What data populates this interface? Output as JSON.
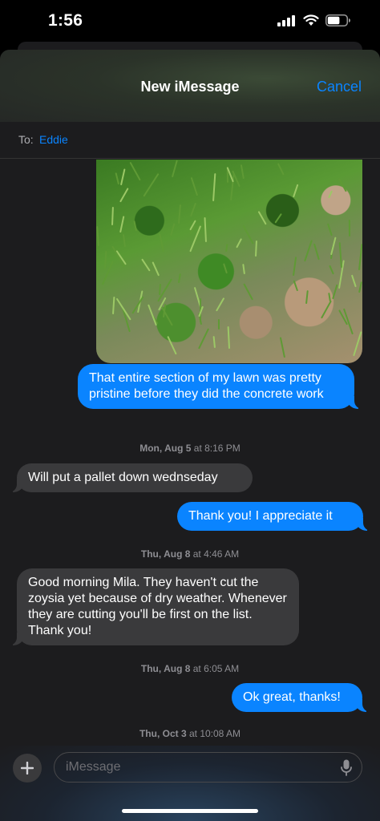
{
  "status_bar": {
    "time": "1:56",
    "battery_level": 0.65
  },
  "nav": {
    "title": "New iMessage",
    "cancel_label": "Cancel"
  },
  "to": {
    "label": "To:",
    "recipient": "Eddie"
  },
  "messages": [
    {
      "kind": "sent",
      "text": "That entire section of my lawn was pretty pristine before they did the concrete work"
    },
    {
      "kind": "timestamp",
      "day": "Mon, Aug 5",
      "time": "at 8:16 PM"
    },
    {
      "kind": "received",
      "text": "Will put a pallet down wednseday"
    },
    {
      "kind": "sent",
      "text": "Thank you! I appreciate it"
    },
    {
      "kind": "timestamp",
      "day": "Thu, Aug 8",
      "time": "at 4:46 AM"
    },
    {
      "kind": "received",
      "text": "Good morning Mila. They haven't cut the zoysia yet because of dry weather. Whenever they are cutting you'll be first on the list. Thank you!"
    },
    {
      "kind": "timestamp",
      "day": "Thu, Aug 8",
      "time": "at 6:05 AM"
    },
    {
      "kind": "sent",
      "text": "Ok great, thanks!"
    },
    {
      "kind": "timestamp",
      "day": "Thu, Oct 3",
      "time": "at 10:08 AM"
    }
  ],
  "compose": {
    "placeholder": "iMessage"
  },
  "icons": {
    "plus": "plus-icon",
    "mic": "microphone-icon",
    "signal": "cellular-signal-icon",
    "wifi": "wifi-icon",
    "battery": "battery-icon"
  },
  "colors": {
    "sent_bubble": "#0a84ff",
    "received_bubble": "#3a3a3c",
    "link": "#0a84ff"
  }
}
